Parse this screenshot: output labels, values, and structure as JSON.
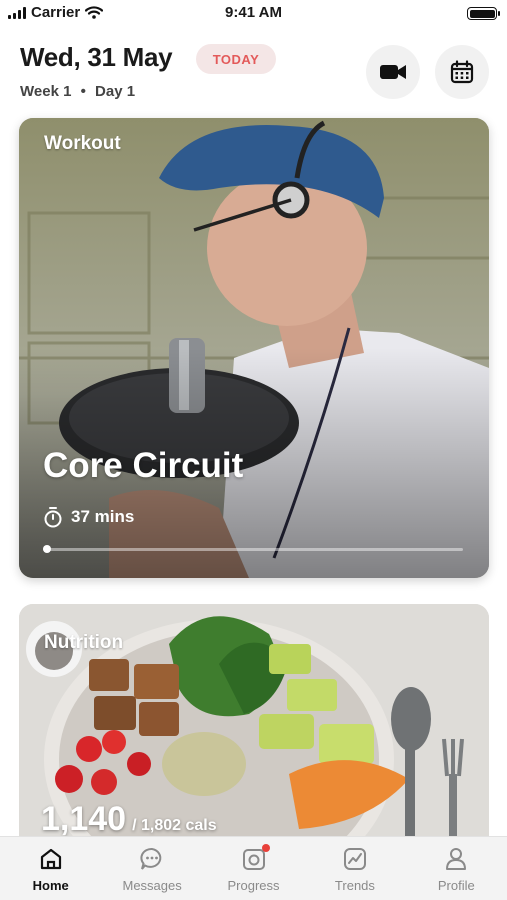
{
  "status_bar": {
    "carrier": "Carrier",
    "time": "9:41 AM"
  },
  "header": {
    "date": "Wed, 31 May",
    "badge": "TODAY",
    "week": "Week 1",
    "separator": "•",
    "day": "Day 1",
    "buttons": [
      "video-icon",
      "calendar-icon"
    ]
  },
  "workout": {
    "label": "Workout",
    "title": "Core Circuit",
    "duration": "37 mins",
    "progress": 0.0
  },
  "nutrition": {
    "label": "Nutrition",
    "calories": "1,140",
    "total": "/ 1,802 cals"
  },
  "tabs": [
    {
      "label": "Home",
      "icon": "home-icon",
      "active": true
    },
    {
      "label": "Messages",
      "icon": "chat-icon"
    },
    {
      "label": "Progress",
      "icon": "camera-icon",
      "notification": true
    },
    {
      "label": "Trends",
      "icon": "trend-icon"
    },
    {
      "label": "Profile",
      "icon": "profile-icon"
    }
  ],
  "colors": {
    "accent": "#e35a5a",
    "badge_bg": "#f4e6e6",
    "tabbar_bg": "#f3f3f3",
    "notification": "#e8403a"
  }
}
